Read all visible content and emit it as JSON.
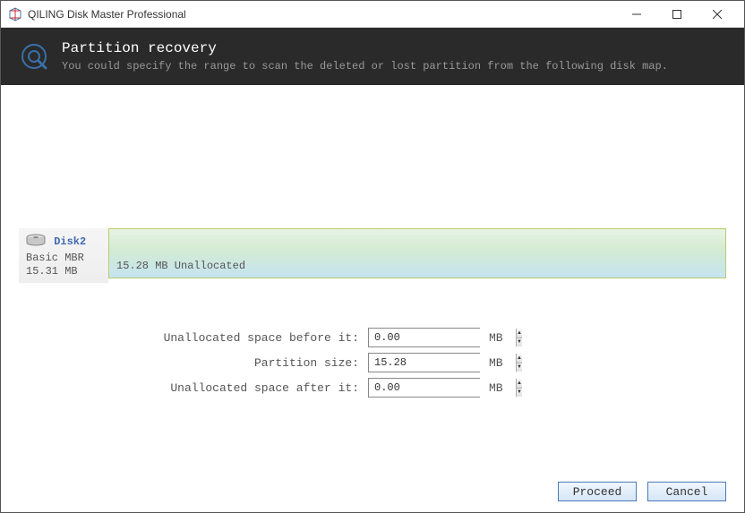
{
  "titlebar": {
    "text": "QILING Disk Master Professional"
  },
  "header": {
    "title": "Partition recovery",
    "subtitle": "You could specify the range to scan the deleted or lost partition from the following disk map."
  },
  "diskMap": {
    "diskName": "Disk2",
    "diskType": "Basic MBR",
    "diskSize": "15.31 MB",
    "allocText": "15.28 MB Unallocated"
  },
  "form": {
    "before": {
      "label": "Unallocated space before it:",
      "value": "0.00",
      "unit": "MB"
    },
    "size": {
      "label": "Partition size:",
      "value": "15.28",
      "unit": "MB"
    },
    "after": {
      "label": "Unallocated space after it:",
      "value": "0.00",
      "unit": "MB"
    }
  },
  "buttons": {
    "proceed": "Proceed",
    "cancel": "Cancel"
  }
}
